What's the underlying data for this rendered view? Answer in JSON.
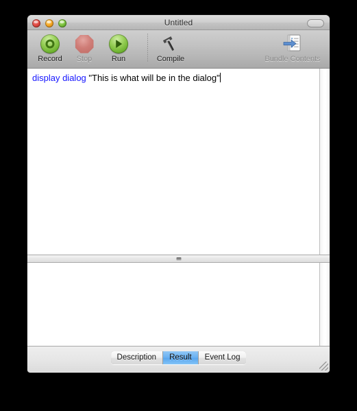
{
  "window": {
    "title": "Untitled",
    "controls": {
      "close": "close-button",
      "minimize": "minimize-button",
      "zoom": "zoom-button",
      "toolbar_toggle": "toolbar-toggle-button"
    }
  },
  "toolbar": {
    "items": [
      {
        "id": "record",
        "label": "Record",
        "icon": "record-circle-icon",
        "enabled": true
      },
      {
        "id": "stop",
        "label": "Stop",
        "icon": "stop-octagon-icon",
        "enabled": false
      },
      {
        "id": "run",
        "label": "Run",
        "icon": "play-triangle-icon",
        "enabled": true
      },
      {
        "id": "compile",
        "label": "Compile",
        "icon": "hammer-icon",
        "enabled": true
      }
    ],
    "right_items": [
      {
        "id": "bundle-contents",
        "label": "Bundle Contents",
        "icon": "document-arrow-icon",
        "enabled": false
      }
    ]
  },
  "editor": {
    "code_keyword": "display dialog",
    "code_string": " \"This is what will be in the dialog\"",
    "keyword_color": "#1414ff",
    "text_color": "#000000",
    "background": "#ffffff"
  },
  "result": {
    "content": ""
  },
  "bottom": {
    "tabs": [
      {
        "id": "description",
        "label": "Description",
        "selected": false
      },
      {
        "id": "result",
        "label": "Result",
        "selected": true
      },
      {
        "id": "event-log",
        "label": "Event Log",
        "selected": false
      }
    ],
    "selected_color": "#5aa7ef"
  }
}
